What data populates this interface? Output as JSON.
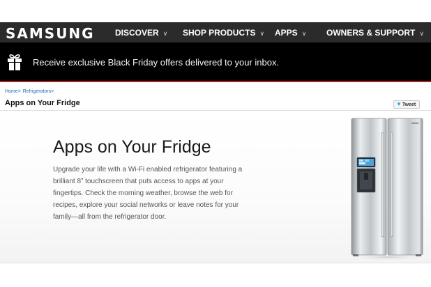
{
  "brand": {
    "logo_text": "SAMSUNG"
  },
  "nav": {
    "items": [
      {
        "label": "DISCOVER"
      },
      {
        "label": "SHOP PRODUCTS"
      },
      {
        "label": "APPS"
      },
      {
        "label": "OWNERS & SUPPORT"
      }
    ],
    "chevron": "∨"
  },
  "promo": {
    "icon": "gift-icon",
    "text": "Receive exclusive Black Friday offers delivered to your inbox."
  },
  "breadcrumb": {
    "items": [
      {
        "label": "Home"
      },
      {
        "label": "Refrigerators"
      }
    ],
    "separator": ">"
  },
  "page": {
    "title": "Apps on Your Fridge",
    "tweet_label": "Tweet"
  },
  "hero": {
    "heading": "Apps on Your Fridge",
    "body": "Upgrade your life with a Wi-Fi enabled refrigerator featuring a brilliant 8” touchscreen that puts access to apps at your fingertips. Check the morning weather, browse the web for recipes, explore your social networks or leave notes for your family—all from the refrigerator door."
  },
  "colors": {
    "nav_bg": "#2b2b2b",
    "promo_bg": "#000000",
    "promo_border": "#b81d23",
    "link": "#1c6ab0"
  }
}
